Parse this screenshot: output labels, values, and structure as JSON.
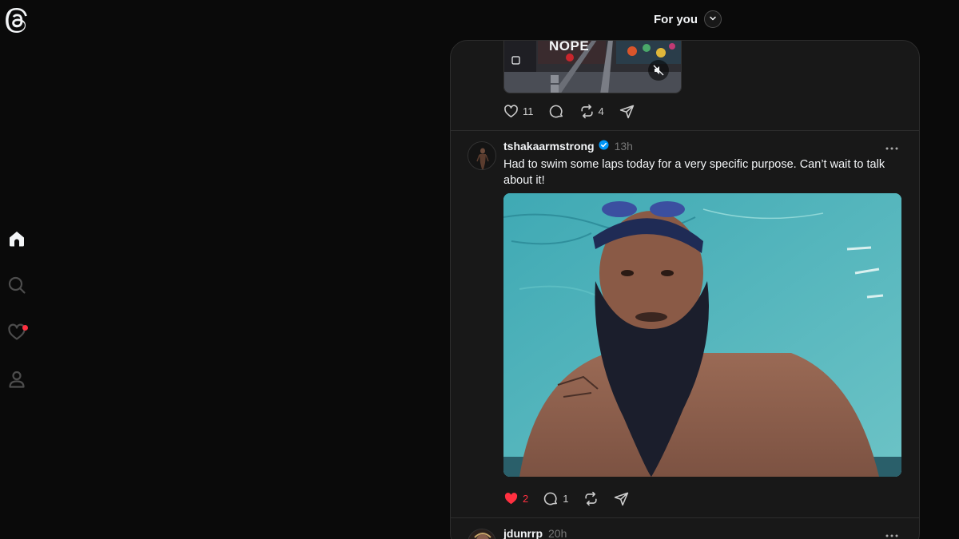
{
  "nav": {
    "logo_icon": "threads-logo-icon",
    "items": [
      {
        "name": "home",
        "icon": "home-icon",
        "active": true
      },
      {
        "name": "search",
        "icon": "search-icon",
        "active": false
      },
      {
        "name": "activity",
        "icon": "heart-icon",
        "active": false,
        "has_notification": true
      },
      {
        "name": "profile",
        "icon": "person-icon",
        "active": false
      }
    ]
  },
  "feed": {
    "title": "For you",
    "dropdown_icon": "chevron-down-icon"
  },
  "posts": [
    {
      "media": {
        "overlay_text": "NOPE",
        "muted_icon": "muted-speaker-icon",
        "has_video": true
      },
      "actions": {
        "likes": "11",
        "replies": "",
        "reposts": "4"
      }
    },
    {
      "username": "tshakaarmstrong",
      "verified": true,
      "time": "13h",
      "text": "Had to swim some laps today for a very specific purpose. Can’t wait to talk about it!",
      "actions": {
        "likes": "2",
        "liked": true,
        "replies": "1",
        "reposts": ""
      }
    },
    {
      "username": "jdunrrp",
      "verified": false,
      "time": "20h"
    }
  ],
  "colors": {
    "background": "#0a0a0a",
    "panel": "#181818",
    "text": "#f3f5f7",
    "secondary_text": "#777777",
    "like_red": "#ff3040",
    "verified_blue": "#0095f6",
    "notification_red": "#ff3040"
  }
}
